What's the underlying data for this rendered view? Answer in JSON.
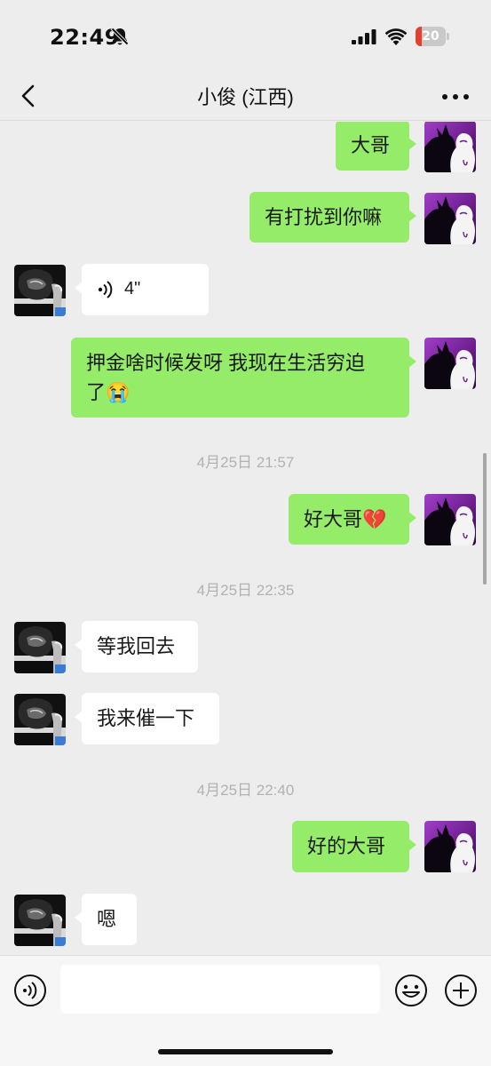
{
  "status_bar": {
    "time": "22:49",
    "battery_level": "20",
    "battery_fraction": 0.2,
    "icons": [
      "bell-slash-icon",
      "cellular-signal-icon",
      "wifi-icon",
      "battery-icon"
    ]
  },
  "header": {
    "title": "小俊 (江西)",
    "back_icon": "chevron-left-icon",
    "more_icon": "more-dots-icon"
  },
  "messages": [
    {
      "side": "out",
      "text": "大哥"
    },
    {
      "side": "out",
      "text": "有打扰到你嘛"
    },
    {
      "side": "in",
      "type": "voice",
      "duration": "4\""
    },
    {
      "side": "out",
      "text": "押金啥时候发呀 我现在生活穷迫",
      "text_line2": "了",
      "emoji": "😭"
    },
    {
      "type": "time",
      "text": "4月25日 21:57"
    },
    {
      "side": "out",
      "text": "好大哥",
      "emoji": "💔"
    },
    {
      "type": "time",
      "text": "4月25日 22:35"
    },
    {
      "side": "in",
      "text": "等我回去"
    },
    {
      "side": "in",
      "text": "我来催一下"
    },
    {
      "type": "time",
      "text": "4月25日 22:40"
    },
    {
      "side": "out",
      "text": "好的大哥"
    },
    {
      "side": "in",
      "text": "嗯"
    }
  ],
  "colors": {
    "background": "#ededed",
    "outgoing_bubble": "#95ec69",
    "incoming_bubble": "#ffffff",
    "timestamp": "#b2b2b2",
    "battery_low": "#e3402f"
  },
  "input_bar": {
    "placeholder": "",
    "icons": [
      "voice-icon",
      "emoji-icon",
      "plus-icon"
    ]
  }
}
